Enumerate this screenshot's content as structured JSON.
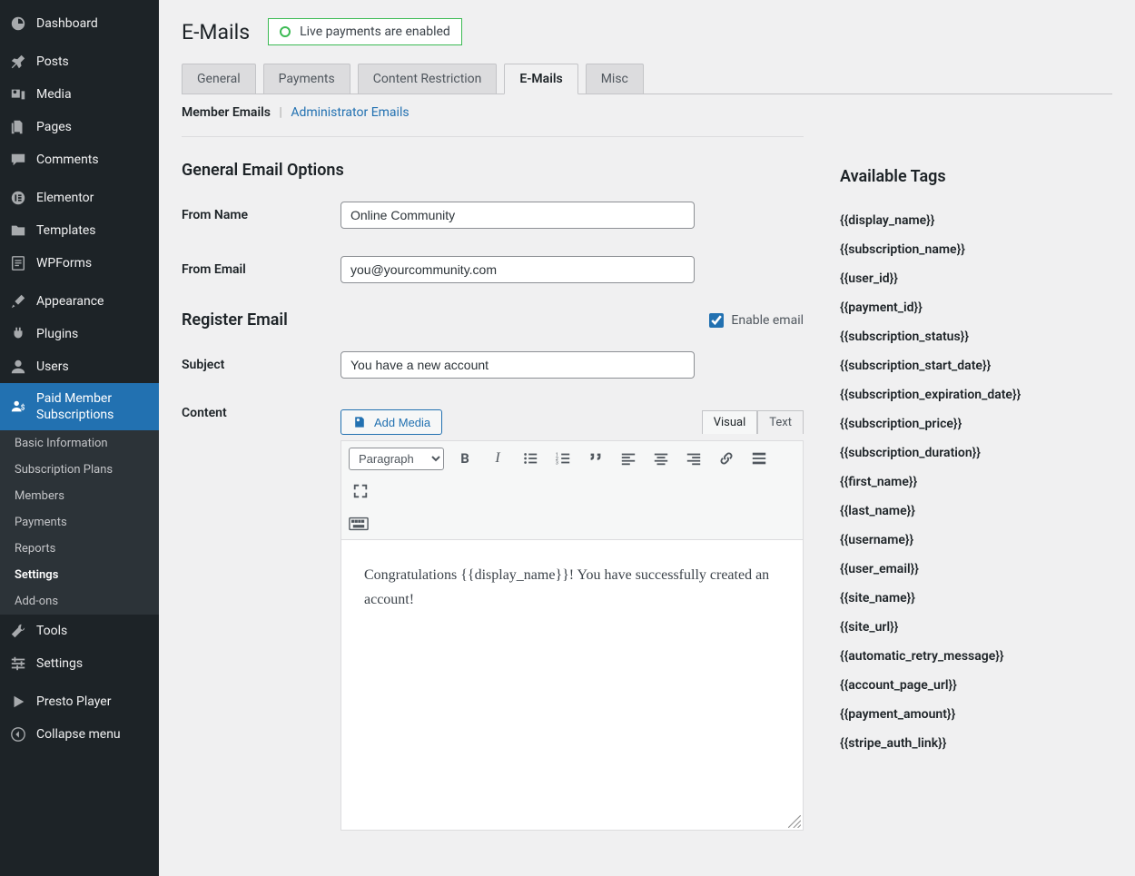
{
  "sidebar": {
    "dashboard": "Dashboard",
    "posts": "Posts",
    "media": "Media",
    "pages": "Pages",
    "comments": "Comments",
    "elementor": "Elementor",
    "templates": "Templates",
    "wpforms": "WPForms",
    "appearance": "Appearance",
    "plugins": "Plugins",
    "users": "Users",
    "pms": "Paid Member Subscriptions",
    "tools": "Tools",
    "settings": "Settings",
    "presto": "Presto Player",
    "collapse": "Collapse menu",
    "sub": {
      "basic": "Basic Information",
      "plans": "Subscription Plans",
      "members": "Members",
      "payments": "Payments",
      "reports": "Reports",
      "settings": "Settings",
      "addons": "Add-ons"
    }
  },
  "header": {
    "title": "E-Mails",
    "live": "Live payments are enabled"
  },
  "tabs": {
    "general": "General",
    "payments": "Payments",
    "content": "Content Restriction",
    "emails": "E-Mails",
    "misc": "Misc"
  },
  "subnav": {
    "member": "Member Emails",
    "admin": "Administrator Emails"
  },
  "section1": {
    "title": "General Email Options",
    "from_name_label": "From Name",
    "from_name_value": "Online Community",
    "from_email_label": "From Email",
    "from_email_value": "you@yourcommunity.com"
  },
  "section2": {
    "title": "Register Email",
    "enable_label": "Enable email",
    "subject_label": "Subject",
    "subject_value": "You have a new account",
    "content_label": "Content",
    "add_media": "Add Media",
    "visual": "Visual",
    "text_tab": "Text",
    "format": "Paragraph",
    "body": "Congratulations {{display_name}}! You have successfully created an account!"
  },
  "tags": {
    "title": "Available Tags",
    "items": [
      "{{display_name}}",
      "{{subscription_name}}",
      "{{user_id}}",
      "{{payment_id}}",
      "{{subscription_status}}",
      "{{subscription_start_date}}",
      "{{subscription_expiration_date}}",
      "{{subscription_price}}",
      "{{subscription_duration}}",
      "{{first_name}}",
      "{{last_name}}",
      "{{username}}",
      "{{user_email}}",
      "{{site_name}}",
      "{{site_url}}",
      "{{automatic_retry_message}}",
      "{{account_page_url}}",
      "{{payment_amount}}",
      "{{stripe_auth_link}}"
    ]
  }
}
